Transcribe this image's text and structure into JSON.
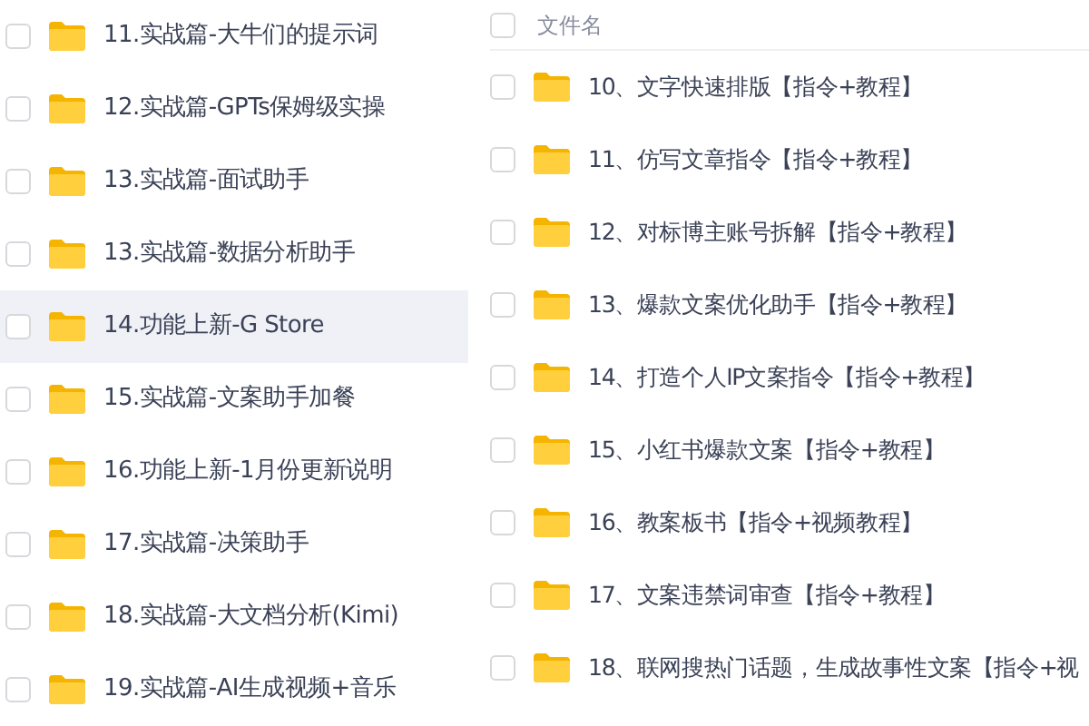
{
  "left_list": {
    "items": [
      {
        "name": "11.实战篇-大牛们的提示词",
        "checked": false,
        "hovered": false
      },
      {
        "name": "12.实战篇-GPTs保姆级实操",
        "checked": false,
        "hovered": false
      },
      {
        "name": "13.实战篇-面试助手",
        "checked": false,
        "hovered": false
      },
      {
        "name": "13.实战篇-数据分析助手",
        "checked": false,
        "hovered": false
      },
      {
        "name": "14.功能上新-G Store",
        "checked": false,
        "hovered": true
      },
      {
        "name": "15.实战篇-文案助手加餐",
        "checked": false,
        "hovered": false
      },
      {
        "name": "16.功能上新-1月份更新说明",
        "checked": false,
        "hovered": false
      },
      {
        "name": "17.实战篇-决策助手",
        "checked": false,
        "hovered": false
      },
      {
        "name": "18.实战篇-大文档分析(Kimi)",
        "checked": false,
        "hovered": false
      },
      {
        "name": "19.实战篇-AI生成视频+音乐",
        "checked": false,
        "hovered": false
      }
    ]
  },
  "right_list": {
    "header": {
      "label": "文件名",
      "checked": false
    },
    "items": [
      {
        "name": "10、文字快速排版【指令+教程】",
        "checked": false
      },
      {
        "name": "11、仿写文章指令【指令+教程】",
        "checked": false
      },
      {
        "name": "12、对标博主账号拆解【指令+教程】",
        "checked": false
      },
      {
        "name": "13、爆款文案优化助手【指令+教程】",
        "checked": false
      },
      {
        "name": "14、打造个人IP文案指令【指令+教程】",
        "checked": false
      },
      {
        "name": "15、小红书爆款文案【指令+教程】",
        "checked": false
      },
      {
        "name": "16、教案板书【指令+视频教程】",
        "checked": false
      },
      {
        "name": "17、文案违禁词审查【指令+教程】",
        "checked": false
      },
      {
        "name": "18、联网搜热门话题，生成故事性文案【指令+视",
        "checked": false
      }
    ]
  }
}
